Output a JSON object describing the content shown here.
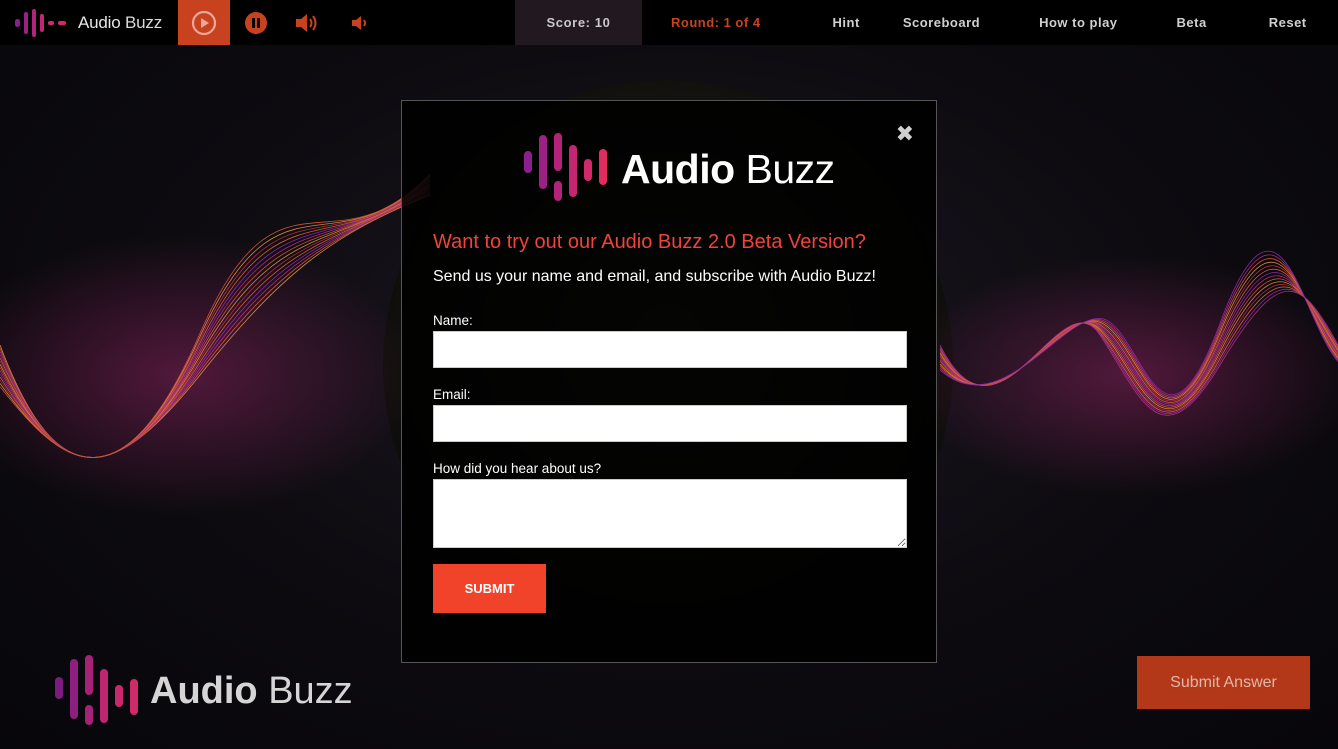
{
  "app": {
    "brand_name_bold": "Audio",
    "brand_name_light": " Buzz"
  },
  "topbar": {
    "score_label": "Score: 10",
    "round_label": "Round: 1 of 4",
    "nav": [
      {
        "label": "Hint"
      },
      {
        "label": "Scoreboard"
      },
      {
        "label": "How to play"
      },
      {
        "label": "Beta"
      },
      {
        "label": "Reset"
      }
    ],
    "controls": [
      "play-icon",
      "pause-icon",
      "volume-up-icon",
      "volume-down-icon"
    ]
  },
  "modal": {
    "logo_bold": "Audio",
    "logo_light": " Buzz",
    "close_glyph": "✖",
    "heading": "Want to try out our Audio Buzz 2.0 Beta Version?",
    "subheading": "Send us your name and email, and subscribe with Audio Buzz!",
    "name_label": "Name:",
    "name_value": "",
    "email_label": "Email:",
    "email_value": "",
    "source_label": "How did you hear about us?",
    "source_value": "",
    "submit_label": "SUBMIT"
  },
  "footer": {
    "logo_bold": "Audio",
    "logo_light": " Buzz",
    "submit_answer_label": "Submit Answer"
  },
  "colors": {
    "accent": "#c9421f",
    "heading_red": "#f0433a",
    "submit_orange": "#f0432a",
    "logo_purple": "#8b1f8f",
    "logo_pink": "#d12a6a"
  }
}
